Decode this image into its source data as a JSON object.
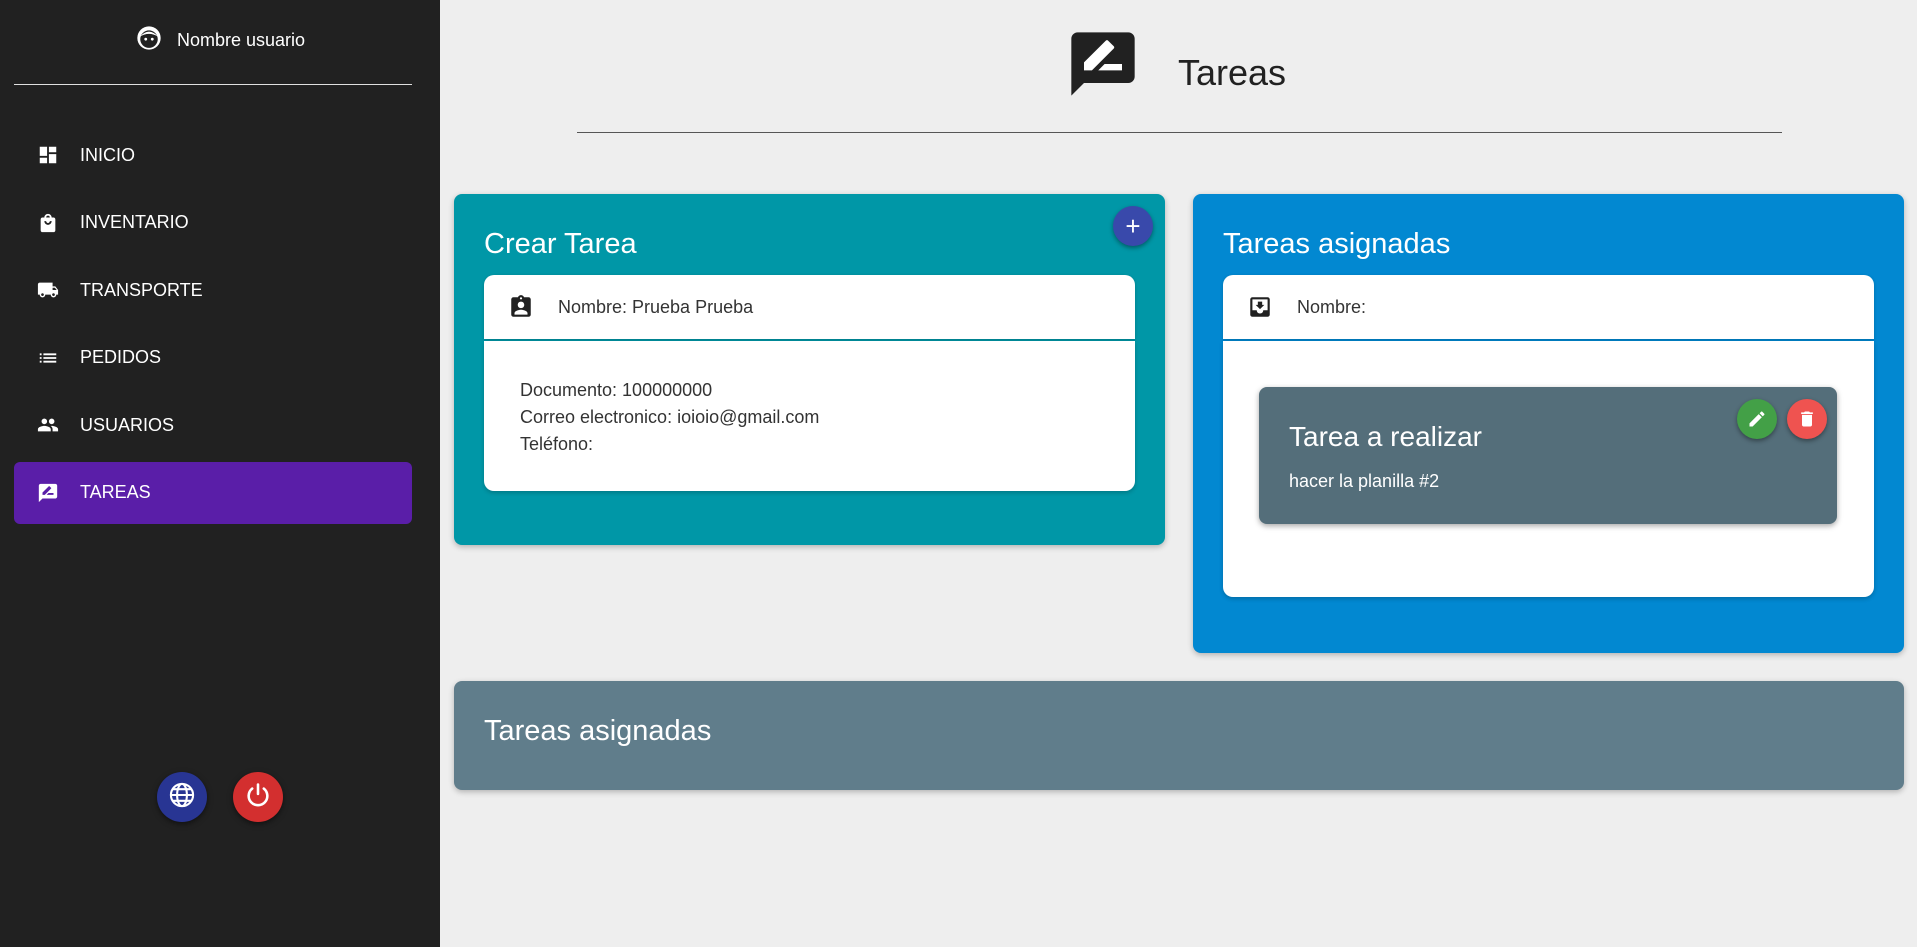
{
  "sidebar": {
    "user_name": "Nombre usuario",
    "items": [
      {
        "label": "INICIO",
        "icon": "dashboard-icon"
      },
      {
        "label": "INVENTARIO",
        "icon": "shopping-bag-icon"
      },
      {
        "label": "TRANSPORTE",
        "icon": "truck-icon"
      },
      {
        "label": "PEDIDOS",
        "icon": "list-icon"
      },
      {
        "label": "USUARIOS",
        "icon": "people-icon"
      },
      {
        "label": "TAREAS",
        "icon": "rate-review-icon",
        "active": true
      }
    ],
    "bottom_buttons": [
      {
        "icon": "globe-icon",
        "color": "#283593"
      },
      {
        "icon": "power-icon",
        "color": "#d32f2f"
      }
    ]
  },
  "header": {
    "title": "Tareas",
    "icon": "rate-review-icon"
  },
  "create_card": {
    "title": "Crear Tarea",
    "add_button": "+",
    "name_line": "Nombre: Prueba Prueba",
    "document_line": "Documento: 100000000",
    "email_line": "Correo electronico: ioioio@gmail.com",
    "phone_line": "Teléfono:",
    "color": "#0097a7"
  },
  "assigned_card": {
    "title": "Tareas asignadas",
    "name_line": "Nombre:",
    "color": "#0288d1",
    "task": {
      "title": "Tarea a realizar",
      "description": "hacer la planilla #2"
    }
  },
  "bottom_card": {
    "title": "Tareas asignadas",
    "color": "#607d8b"
  },
  "colors": {
    "sidebar_bg": "#212121",
    "active_item": "#5a1ea8",
    "page_bg": "#eeeeee"
  }
}
